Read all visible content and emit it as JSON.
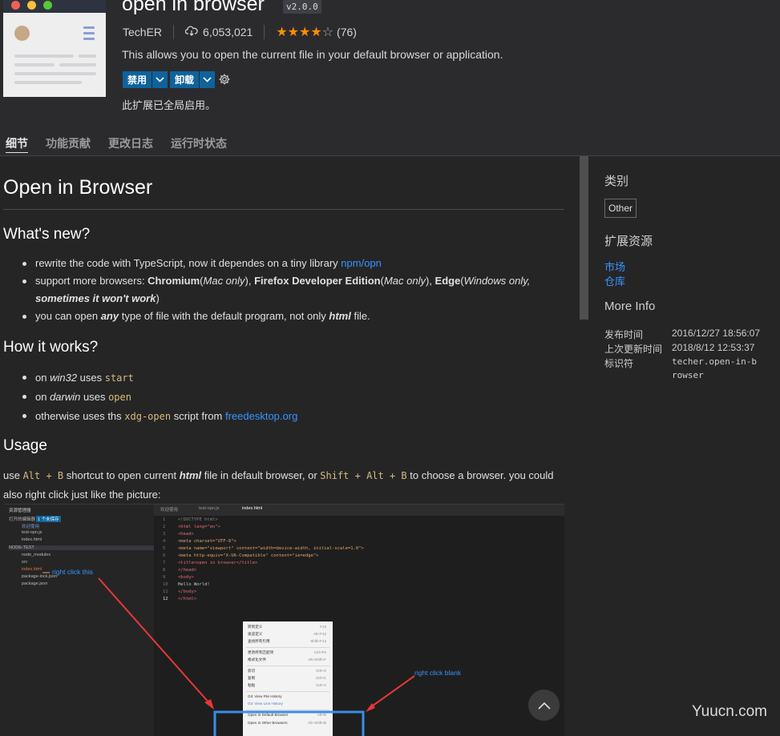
{
  "header": {
    "name": "open in browser",
    "version": "v2.0.0",
    "publisher": "TechER",
    "installs": "6,053,021",
    "rating_count": "(76)",
    "rating_stars": 4,
    "description": "This allows you to open the current file in your default browser or application.",
    "disable_label": "禁用",
    "uninstall_label": "卸载",
    "enabled_note": "此扩展已全局启用。"
  },
  "tabs": [
    {
      "label": "细节",
      "active": true
    },
    {
      "label": "功能贡献",
      "active": false
    },
    {
      "label": "更改日志",
      "active": false
    },
    {
      "label": "运行时状态",
      "active": false
    }
  ],
  "readme": {
    "title": "Open in Browser",
    "whats_new": {
      "heading": "What's new?",
      "item1": {
        "text": "rewrite the code with TypeScript, now it dependes on a tiny library ",
        "link": "npm/opn"
      },
      "item2": {
        "a": "support more browsers: ",
        "b": "Chromium",
        "c": "(",
        "d": "Mac only",
        "e": "), ",
        "f": "Firefox Developer Edition",
        "g": "(",
        "h": "Mac only",
        "i": "), ",
        "j": "Edge",
        "k": "(",
        "l": "Windows only, ",
        "m": "sometimes it won't work",
        "n": ")"
      },
      "item3": {
        "a": "you can open ",
        "b": "any",
        "c": " type of file with the default program, not only ",
        "d": "html",
        "e": " file."
      }
    },
    "how": {
      "heading": "How it works?",
      "item1": {
        "a": "on ",
        "b": "win32",
        "c": " uses ",
        "code": "start"
      },
      "item2": {
        "a": "on ",
        "b": "darwin",
        "c": " uses ",
        "code": "open"
      },
      "item3": {
        "a": "otherwise uses ths ",
        "code": "xdg-open",
        "c": " script from ",
        "link": "freedesktop.org"
      }
    },
    "usage": {
      "heading": "Usage",
      "a": "use ",
      "code1": "Alt + B",
      "b": " shortcut to open current ",
      "c": "html",
      "d": " file in default browser, or ",
      "code2": "Shift + Alt + B",
      "e": " to choose a browser. you could also right click just like the picture:"
    }
  },
  "picture": {
    "tree_header": "资源管理器",
    "open_editors": "打开的编辑器",
    "open_editors_badge": "1 个未保存",
    "tree_items": [
      "欢迎使用",
      "test-opn.js",
      "index.html"
    ],
    "project": "NODE-TEST",
    "files": [
      "node_modules",
      "src",
      "index.html",
      "package-lock.json",
      "package.json"
    ],
    "editor_tabs": [
      "欢迎使用",
      "test-opn.js",
      "index.html"
    ],
    "line_numbers": [
      "1",
      "2",
      "3",
      "4",
      "5",
      "6",
      "7",
      "8",
      "9",
      "10",
      "11",
      "12"
    ],
    "code_lines": [
      "<!DOCTYPE html>",
      "<html lang=\"en\">",
      "<head>",
      "  <meta charset=\"UTF-8\">",
      "  <meta name=\"viewport\" content=\"width=device-width, initial-scale=1.0\">",
      "  <meta http-equiv=\"X-UA-Compatible\" content=\"ie=edge\">",
      "  <title>open in browser</title>",
      "</head>",
      "<body>",
      "  Hello World!",
      "</body>",
      "</html>"
    ],
    "menu": [
      {
        "label": "转到定义",
        "key": "F12"
      },
      {
        "label": "速览定义",
        "key": "Alt+F12"
      },
      {
        "label": "查找所有引用",
        "key": "Shift+F12"
      },
      {
        "label": "更改所有匹配项",
        "key": "Ctrl+F2"
      },
      {
        "label": "格式化文件",
        "key": "Alt+Shift+F"
      },
      {
        "label": "剪切",
        "key": "Ctrl+X"
      },
      {
        "label": "复制",
        "key": "Ctrl+C"
      },
      {
        "label": "粘贴",
        "key": "Ctrl+V"
      },
      {
        "label": "Git: View File History",
        "key": ""
      },
      {
        "label": "Git: View Line History",
        "key": ""
      },
      {
        "label": "Open In Default Browser",
        "key": "Alt+B"
      },
      {
        "label": "Open In Other Browsers",
        "key": "Alt+Shift+B"
      }
    ],
    "anno_file": "right click this",
    "anno_blank": "right click blank"
  },
  "sidebar": {
    "category_heading": "类别",
    "category": "Other",
    "resources_heading": "扩展资源",
    "marketplace": "市场",
    "repository": "仓库",
    "more_info_heading": "More Info",
    "published_label": "发布时间",
    "published_value": "2016/12/27 18:56:07",
    "updated_label": "上次更新时间",
    "updated_value": "2018/8/12 12:53:37",
    "identifier_label": "标识符",
    "identifier_value": "techer.open-in-browser"
  },
  "watermark": "Yuucn.com",
  "colors": {
    "accent": "#0e639c",
    "link": "#3794ff",
    "star": "#ff8e00",
    "code": "#d7ba7d"
  }
}
